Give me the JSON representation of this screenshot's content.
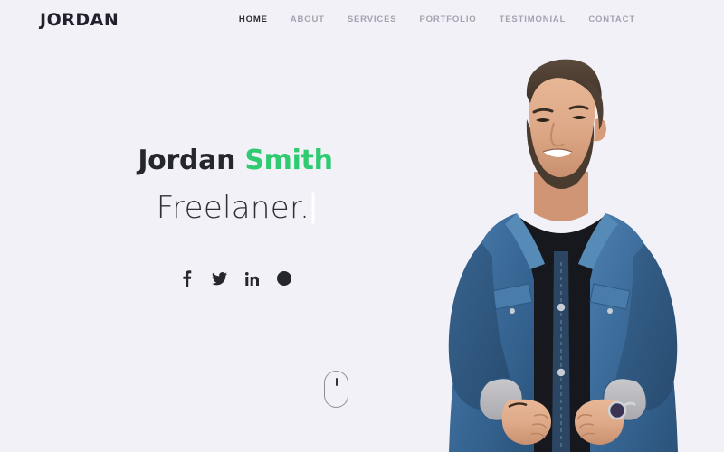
{
  "theme": {
    "background": "#f2f1f8",
    "accent_green": "#2ecb71",
    "text_dark": "#26262f",
    "nav_inactive": "#a3a3b0",
    "mouse_outline": "#8d8d9c"
  },
  "header": {
    "logo": "JORDAN",
    "nav": [
      {
        "label": "HOME",
        "active": true
      },
      {
        "label": "ABOUT",
        "active": false
      },
      {
        "label": "SERVICES",
        "active": false
      },
      {
        "label": "PORTFOLIO",
        "active": false
      },
      {
        "label": "TESTIMONIAL",
        "active": false
      },
      {
        "label": "CONTACT",
        "active": false
      }
    ]
  },
  "hero": {
    "name_first": "Jordan",
    "name_last": "Smith",
    "role_typed_text": "Freelaner.",
    "socials": [
      {
        "icon": "facebook-icon",
        "label": "Facebook"
      },
      {
        "icon": "twitter-icon",
        "label": "Twitter"
      },
      {
        "icon": "linkedin-icon",
        "label": "LinkedIn"
      },
      {
        "icon": "pinterest-icon",
        "label": "Pinterest"
      }
    ],
    "scroll_hint_icon": "mouse-scroll-icon",
    "photo_alt": "Smiling bearded man in blue denim jacket over black t-shirt"
  }
}
